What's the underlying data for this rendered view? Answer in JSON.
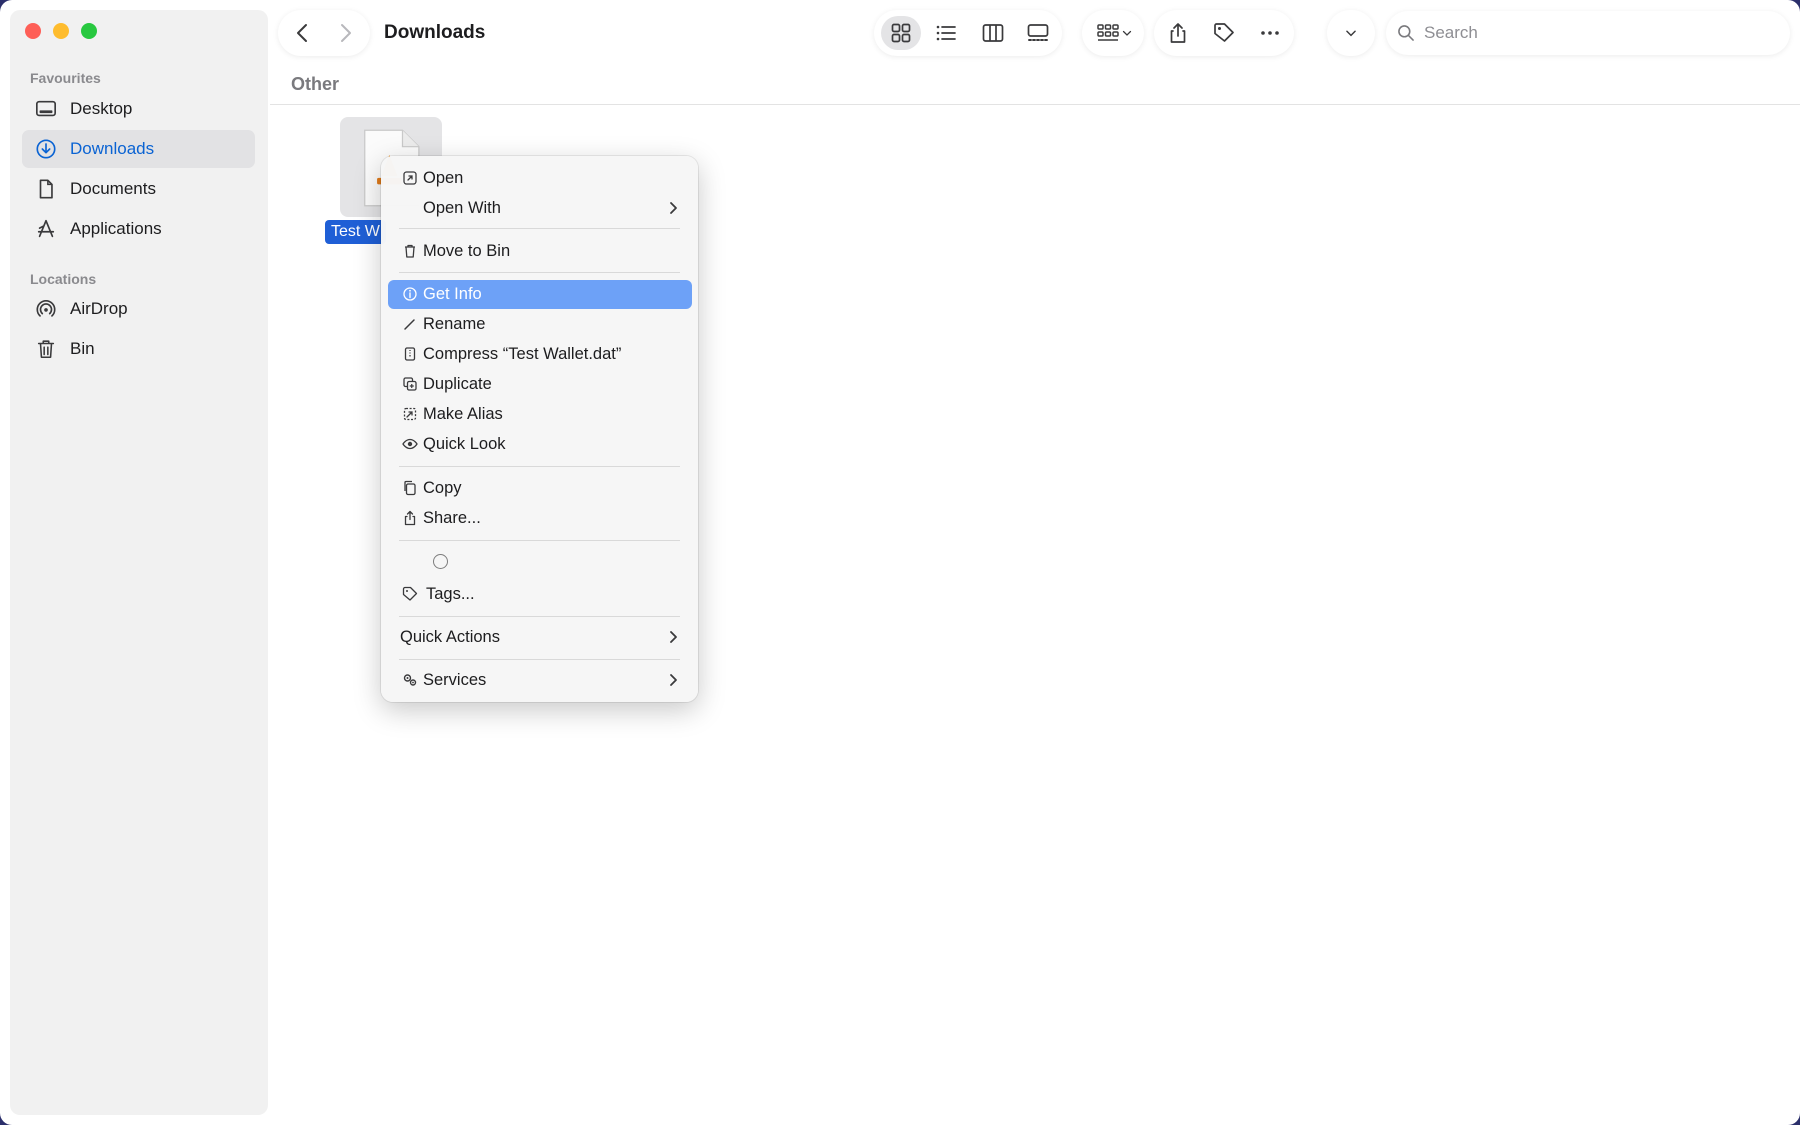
{
  "window": {
    "title": "Downloads"
  },
  "sidebar": {
    "sections": [
      {
        "title": "Favourites",
        "items": [
          {
            "label": "Desktop",
            "icon": "desktop-icon"
          },
          {
            "label": "Downloads",
            "icon": "downloads-icon",
            "active": true
          },
          {
            "label": "Documents",
            "icon": "document-icon"
          },
          {
            "label": "Applications",
            "icon": "applications-icon"
          }
        ]
      },
      {
        "title": "Locations",
        "items": [
          {
            "label": "AirDrop",
            "icon": "airdrop-icon"
          },
          {
            "label": "Bin",
            "icon": "trash-icon"
          }
        ]
      }
    ]
  },
  "toolbar": {
    "search_placeholder": "Search",
    "view_modes": [
      "icon-view",
      "list-view",
      "column-view",
      "gallery-view"
    ],
    "active_view": "icon-view"
  },
  "content": {
    "group_title": "Other",
    "file": {
      "label": "Test W",
      "selected": true
    }
  },
  "context_menu": {
    "open": "Open",
    "open_with": "Open With",
    "move_to_bin": "Move to Bin",
    "get_info": "Get Info",
    "rename": "Rename",
    "compress": "Compress “Test Wallet.dat”",
    "duplicate": "Duplicate",
    "make_alias": "Make Alias",
    "quick_look": "Quick Look",
    "copy": "Copy",
    "share": "Share...",
    "tags": "Tags...",
    "quick_actions": "Quick Actions",
    "services": "Services",
    "highlighted": "Get Info"
  },
  "colors": {
    "accent": "#0a63d3",
    "selection": "#1f5fd6",
    "menu_highlight": "#6da1f7"
  }
}
